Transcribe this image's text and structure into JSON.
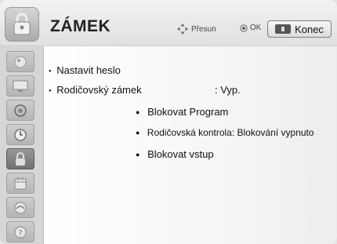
{
  "header": {
    "title": "ZÁMEK",
    "nav_label": "Přesun",
    "ok_label": "OK",
    "exit_label": "Konec"
  },
  "sidebar": {
    "items": [
      {
        "icon": "picture-icon",
        "active": false
      },
      {
        "icon": "tv-screen-icon",
        "active": false
      },
      {
        "icon": "audio-icon",
        "active": false
      },
      {
        "icon": "clock-icon",
        "active": false
      },
      {
        "icon": "lock-icon",
        "active": true
      },
      {
        "icon": "calendar-icon",
        "active": false
      },
      {
        "icon": "network-icon",
        "active": false
      },
      {
        "icon": "help-icon",
        "active": false
      }
    ]
  },
  "menu": {
    "set_password": "Nastavit heslo",
    "parental_lock_label": "Rodičovský zámek",
    "parental_lock_value": ": Vyp.",
    "block_program": "Blokovat Program",
    "parental_control": "Rodičovská kontrola: Blokování vypnuto",
    "block_input": "Blokovat vstup"
  }
}
